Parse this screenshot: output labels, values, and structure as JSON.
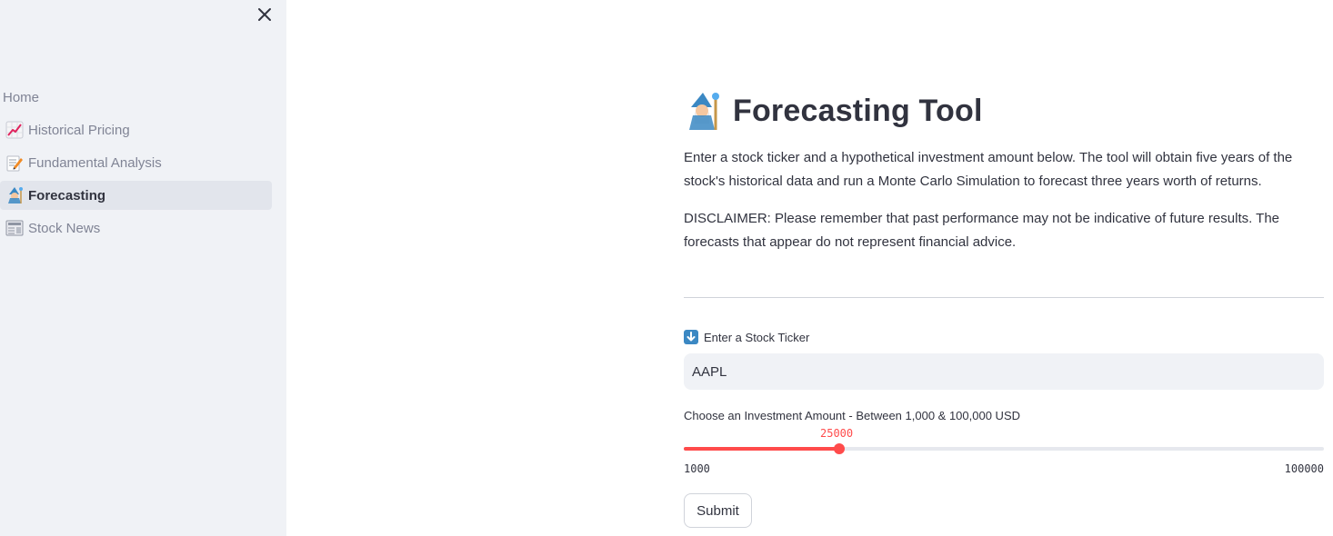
{
  "sidebar": {
    "items": [
      {
        "label": "Home",
        "icon": "none",
        "active": false
      },
      {
        "label": "Historical Pricing",
        "icon": "chart-increasing-icon",
        "active": false
      },
      {
        "label": "Fundamental Analysis",
        "icon": "memo-icon",
        "active": false
      },
      {
        "label": "Forecasting",
        "icon": "wizard-icon",
        "active": true
      },
      {
        "label": "Stock News",
        "icon": "newspaper-icon",
        "active": false
      }
    ]
  },
  "main": {
    "title": "Forecasting Tool",
    "title_icon": "wizard-icon",
    "intro": "Enter a stock ticker and a hypothetical investment amount below. The tool will obtain five years of the stock's historical data and run a Monte Carlo Simulation to forecast three years worth of returns.",
    "disclaimer": "DISCLAIMER: Please remember that past performance may not be indicative of future results. The forecasts that appear do not represent financial advice."
  },
  "ticker": {
    "label": "Enter a Stock Ticker",
    "label_icon": "down-arrow-icon",
    "value": "AAPL"
  },
  "slider": {
    "label": "Choose an Investment Amount - Between 1,000 & 100,000 USD",
    "value": "25000",
    "min": "1000",
    "max": "100000"
  },
  "submit_label": "Submit",
  "colors": {
    "accent": "#ff4b4b",
    "sidebar_bg": "#f0f2f6",
    "text": "#31333f",
    "muted": "#808495"
  }
}
